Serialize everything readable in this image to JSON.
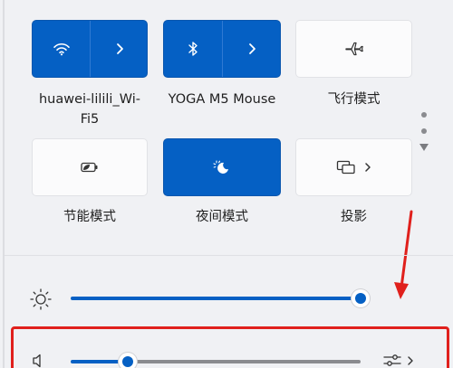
{
  "quick_settings": {
    "tiles": [
      {
        "id": "wifi",
        "label": "huawei-lilili_Wi-Fi5",
        "label_line1": "huawei-lilili_Wi-",
        "label_line2": "Fi5",
        "state": "on",
        "icon": "wifi-icon",
        "has_chevron": true
      },
      {
        "id": "bluetooth",
        "label": "YOGA M5 Mouse",
        "state": "on",
        "icon": "bluetooth-icon",
        "has_chevron": true
      },
      {
        "id": "airplane",
        "label": "飞行模式",
        "state": "off",
        "icon": "airplane-icon",
        "has_chevron": false
      },
      {
        "id": "battery_saver",
        "label": "节能模式",
        "state": "off",
        "icon": "battery-saver-icon",
        "has_chevron": false
      },
      {
        "id": "night_light",
        "label": "夜间模式",
        "state": "on",
        "icon": "night-light-icon",
        "has_chevron": false
      },
      {
        "id": "project",
        "label": "投影",
        "state": "off",
        "icon": "project-icon",
        "has_chevron": true
      }
    ],
    "brightness": {
      "icon": "sun-icon",
      "level": 1.0
    },
    "volume": {
      "icon": "speaker-icon",
      "level": 0.17,
      "output_icon": "audio-output-icon"
    }
  },
  "colors": {
    "accent": "#0560c4",
    "annotation_red": "#e0201c"
  }
}
